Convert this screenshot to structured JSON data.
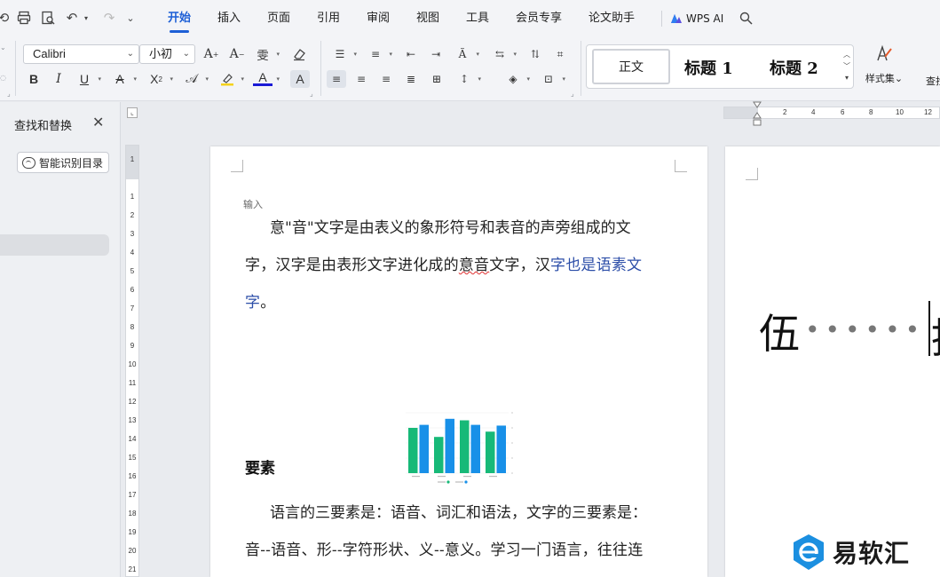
{
  "toolbar_tabs": [
    {
      "label": "开始",
      "active": true
    },
    {
      "label": "插入"
    },
    {
      "label": "页面"
    },
    {
      "label": "引用"
    },
    {
      "label": "审阅"
    },
    {
      "label": "视图"
    },
    {
      "label": "工具"
    },
    {
      "label": "会员专享"
    },
    {
      "label": "论文助手"
    }
  ],
  "wps_ai": "WPS AI",
  "font": {
    "name": "Calibri",
    "size": "小初"
  },
  "styles": {
    "normal": "正文",
    "h1": "标题 1",
    "h2": "标题 2",
    "set_label": "样式集",
    "find_label": "查找替换"
  },
  "left_panel": {
    "title": "查找和替换",
    "smart_toc_button": "智能识别目录"
  },
  "vruler_numbers": [
    "1",
    "1",
    "2",
    "3",
    "4",
    "5",
    "6",
    "7",
    "8",
    "9",
    "10",
    "11",
    "12",
    "13",
    "14",
    "15",
    "16",
    "17",
    "18",
    "19",
    "20",
    "21"
  ],
  "hruler_numbers": [
    "2",
    "4",
    "6",
    "8",
    "10",
    "12"
  ],
  "page1": {
    "input_label": "输入",
    "para1": {
      "line1": "意\"音\"文字是由表义的象形符号和表音的声旁组成的文",
      "line2_a": "字，汉字是由表形文字进化成的",
      "line2_squig": "意音",
      "line2_b": "文字，汉",
      "line2_blue": "字也是语素文",
      "line3_blue": "字",
      "line3_end": "。"
    },
    "heading": "要素",
    "para2": {
      "line1": "语言的三要素是：语音、词汇和语法，文字的三要素是：",
      "line2": "音--语音、形--字符形状、义--意义。学习一门语言，往往连"
    }
  },
  "page2": {
    "big_char": "伍",
    "tail_char": "推"
  },
  "watermark": "易软汇",
  "chart_data": {
    "type": "bar",
    "series": [
      {
        "color": "#17b978",
        "values": [
          60,
          48,
          70,
          55
        ]
      },
      {
        "color": "#1890e8",
        "values": [
          64,
          72,
          64,
          63
        ]
      }
    ],
    "ylim": [
      0,
      80
    ]
  },
  "colors": {
    "accent": "#1d5fd6",
    "page_bg": "#e9ebef",
    "watermark_blue": "#1b8fe0"
  }
}
